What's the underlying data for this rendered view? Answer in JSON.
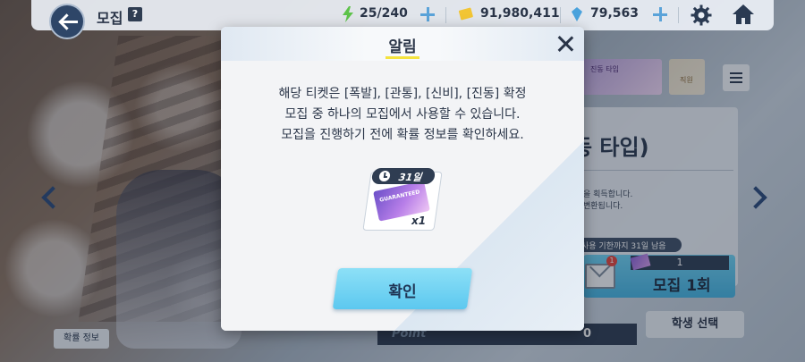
{
  "header": {
    "title": "모집",
    "help_label": "?",
    "ap": "25/240",
    "credits": "91,980,411",
    "gems": "79,563"
  },
  "banner": {
    "thumb_label": "진동 타입",
    "thumb2_label": "직원"
  },
  "side_panel": {
    "title": "동 타입)",
    "desc_line1": "을 획득합니다.",
    "desc_line2": "변환됩니다.",
    "expiry_text": "사용 기한까지 31일 남음",
    "ticket_count": "1",
    "recruit_label": "모집 1회",
    "mail_badge": "1",
    "student_select": "학생 선택",
    "point_label": "Point",
    "point_value": "0"
  },
  "probability_button": "확률 정보",
  "modal": {
    "title": "알림",
    "message_lines": [
      "해당 티켓은 [폭발], [관통], [신비], [진동] 확정",
      "모집 중 하나의 모집에서 사용할 수 있습니다.",
      "모집을 진행하기 전에 확률 정보를 확인하세요."
    ],
    "ticket": {
      "timer": "31일",
      "art_text": "GUARANTEED",
      "quantity": "x1"
    },
    "confirm_label": "확인"
  },
  "colors": {
    "accent": "#5cc8ef",
    "dark": "#2f3d52",
    "title_underline": "#f4e33e"
  }
}
